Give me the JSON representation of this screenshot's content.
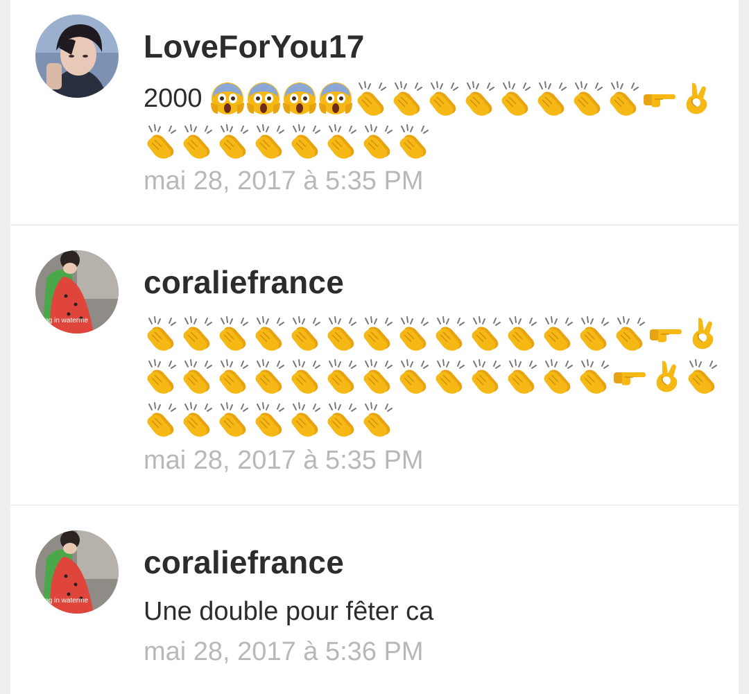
{
  "colors": {
    "username": "#2c2c2c",
    "body": "#2c2c2c",
    "timestamp": "#b8b8b8",
    "divider": "#e2e2e2",
    "emoji_yellow": "#f5b815"
  },
  "comments": [
    {
      "username": "LoveForYou17",
      "avatar": "profile-photo-dark-hair",
      "text_prefix": "2000",
      "emoji_lines": [
        [
          "scream",
          "scream",
          "scream",
          "scream",
          "clap",
          "clap",
          "clap",
          "clap",
          "clap",
          "clap",
          "clap",
          "clap",
          "point-right",
          "ok-hand"
        ],
        [
          "clap",
          "clap",
          "clap",
          "clap",
          "clap",
          "clap",
          "clap",
          "clap"
        ]
      ],
      "timestamp": "mai 28, 2017 à 5:35 PM"
    },
    {
      "username": "coraliefrance",
      "avatar": "profile-photo-watermelon",
      "avatar_caption": "ving in waterme",
      "emoji_lines": [
        [
          "clap",
          "clap",
          "clap",
          "clap",
          "clap",
          "clap",
          "clap",
          "clap",
          "clap",
          "clap",
          "clap",
          "clap",
          "clap",
          "clap",
          "point-right",
          "ok-hand"
        ],
        [
          "clap",
          "clap",
          "clap",
          "clap",
          "clap",
          "clap",
          "clap",
          "clap",
          "clap",
          "clap",
          "clap",
          "clap",
          "clap",
          "point-right",
          "ok-hand",
          "clap"
        ],
        [
          "clap",
          "clap",
          "clap",
          "clap",
          "clap",
          "clap",
          "clap"
        ]
      ],
      "timestamp": "mai 28, 2017 à 5:35 PM"
    },
    {
      "username": "coraliefrance",
      "avatar": "profile-photo-watermelon",
      "avatar_caption": "ving in waterme",
      "text": "Une double pour fêter ca",
      "timestamp": "mai 28, 2017 à 5:36 PM"
    }
  ]
}
